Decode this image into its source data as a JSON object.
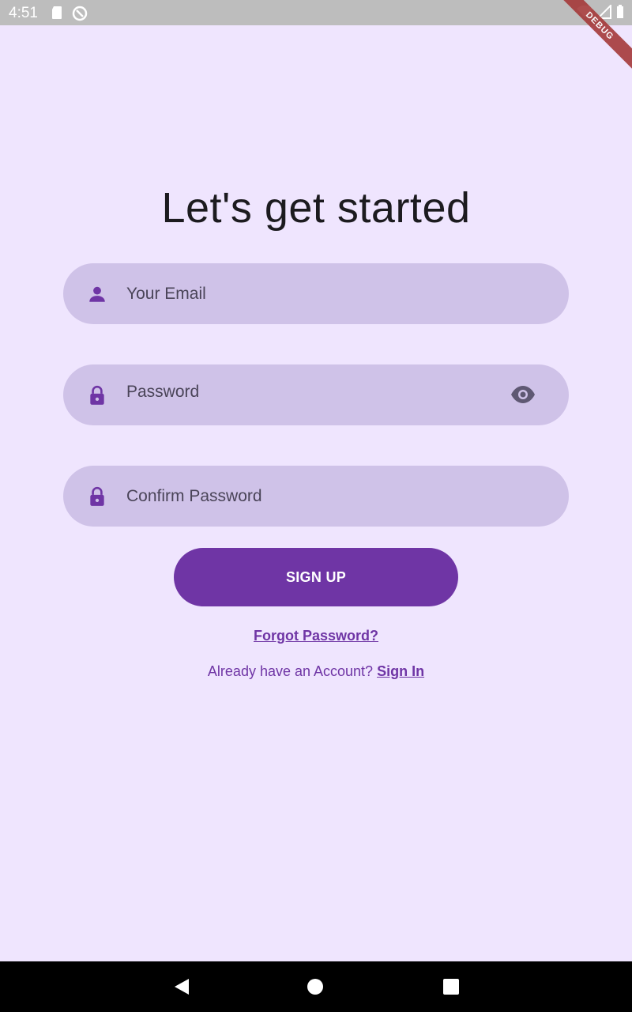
{
  "status_bar": {
    "time": "4:51",
    "debug_label": "DEBUG"
  },
  "page": {
    "title": "Let's get started"
  },
  "fields": {
    "email_placeholder": "Your Email",
    "password_placeholder": "Password",
    "confirm_placeholder": "Confirm Password"
  },
  "actions": {
    "signup_label": "SIGN UP",
    "forgot_label": "Forgot Password?",
    "account_prompt": "Already have an Account? ",
    "signin_label": "Sign In"
  },
  "icons": {
    "email": "person-icon",
    "password": "lock-icon",
    "confirm": "lock-icon",
    "visibility": "eye-icon"
  },
  "colors": {
    "background": "#efe5fe",
    "field_fill": "#cfc2e8",
    "primary": "#6f35a5"
  }
}
